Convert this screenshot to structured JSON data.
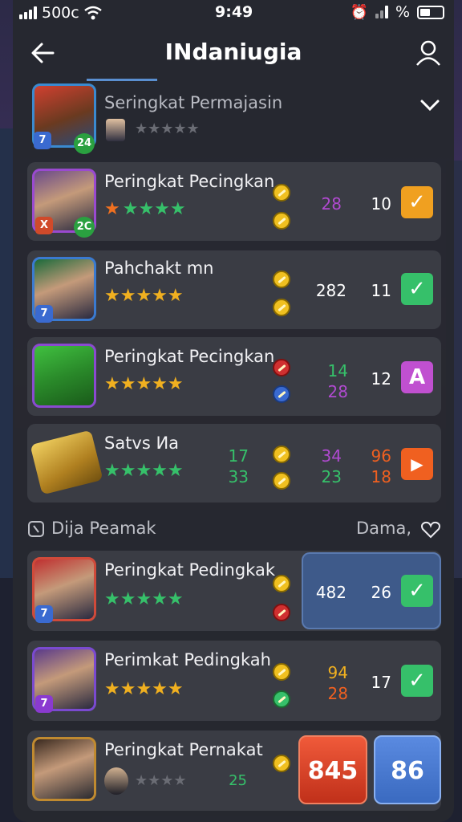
{
  "status": {
    "carrier": "500c",
    "time": "9:49",
    "battery_label": "%"
  },
  "appbar": {
    "title": "INdaniugia"
  },
  "header_row": {
    "name": "Seringkat Permajasin"
  },
  "rows": [
    {
      "name": "Peringkat Pecingkan",
      "badge_a": "X",
      "badge_b": "2C",
      "v1": "28",
      "v2": "10",
      "action": "✓"
    },
    {
      "name": "Pahchakt mn",
      "v1": "282",
      "v2": "11",
      "action": "✓"
    },
    {
      "name": "Peringkat Pecingkan",
      "v1a": "14",
      "v1b": "28",
      "v2": "12",
      "action": "A"
    },
    {
      "name": "Satvs Иa",
      "a1": "17",
      "a2": "33",
      "b1": "34",
      "b2": "23",
      "c1": "96",
      "c2": "18",
      "action": "▶"
    }
  ],
  "section": {
    "left": "Dija Peamak",
    "right": "Dama,"
  },
  "rows2": [
    {
      "name": "Peringkat Pedingkak",
      "v1": "482",
      "v2": "26",
      "action": "✓"
    },
    {
      "name": "Perimkat Pedingkah",
      "v1a": "94",
      "v1b": "28",
      "v2": "17",
      "action": "✓"
    },
    {
      "name": "Peringkat Pernakat",
      "v1": "25",
      "box1": "845",
      "box2": "86"
    }
  ],
  "colors": {
    "green": "#36c06a",
    "orange": "#f0a020",
    "purple": "#b04ad0",
    "red": "#f06020"
  }
}
